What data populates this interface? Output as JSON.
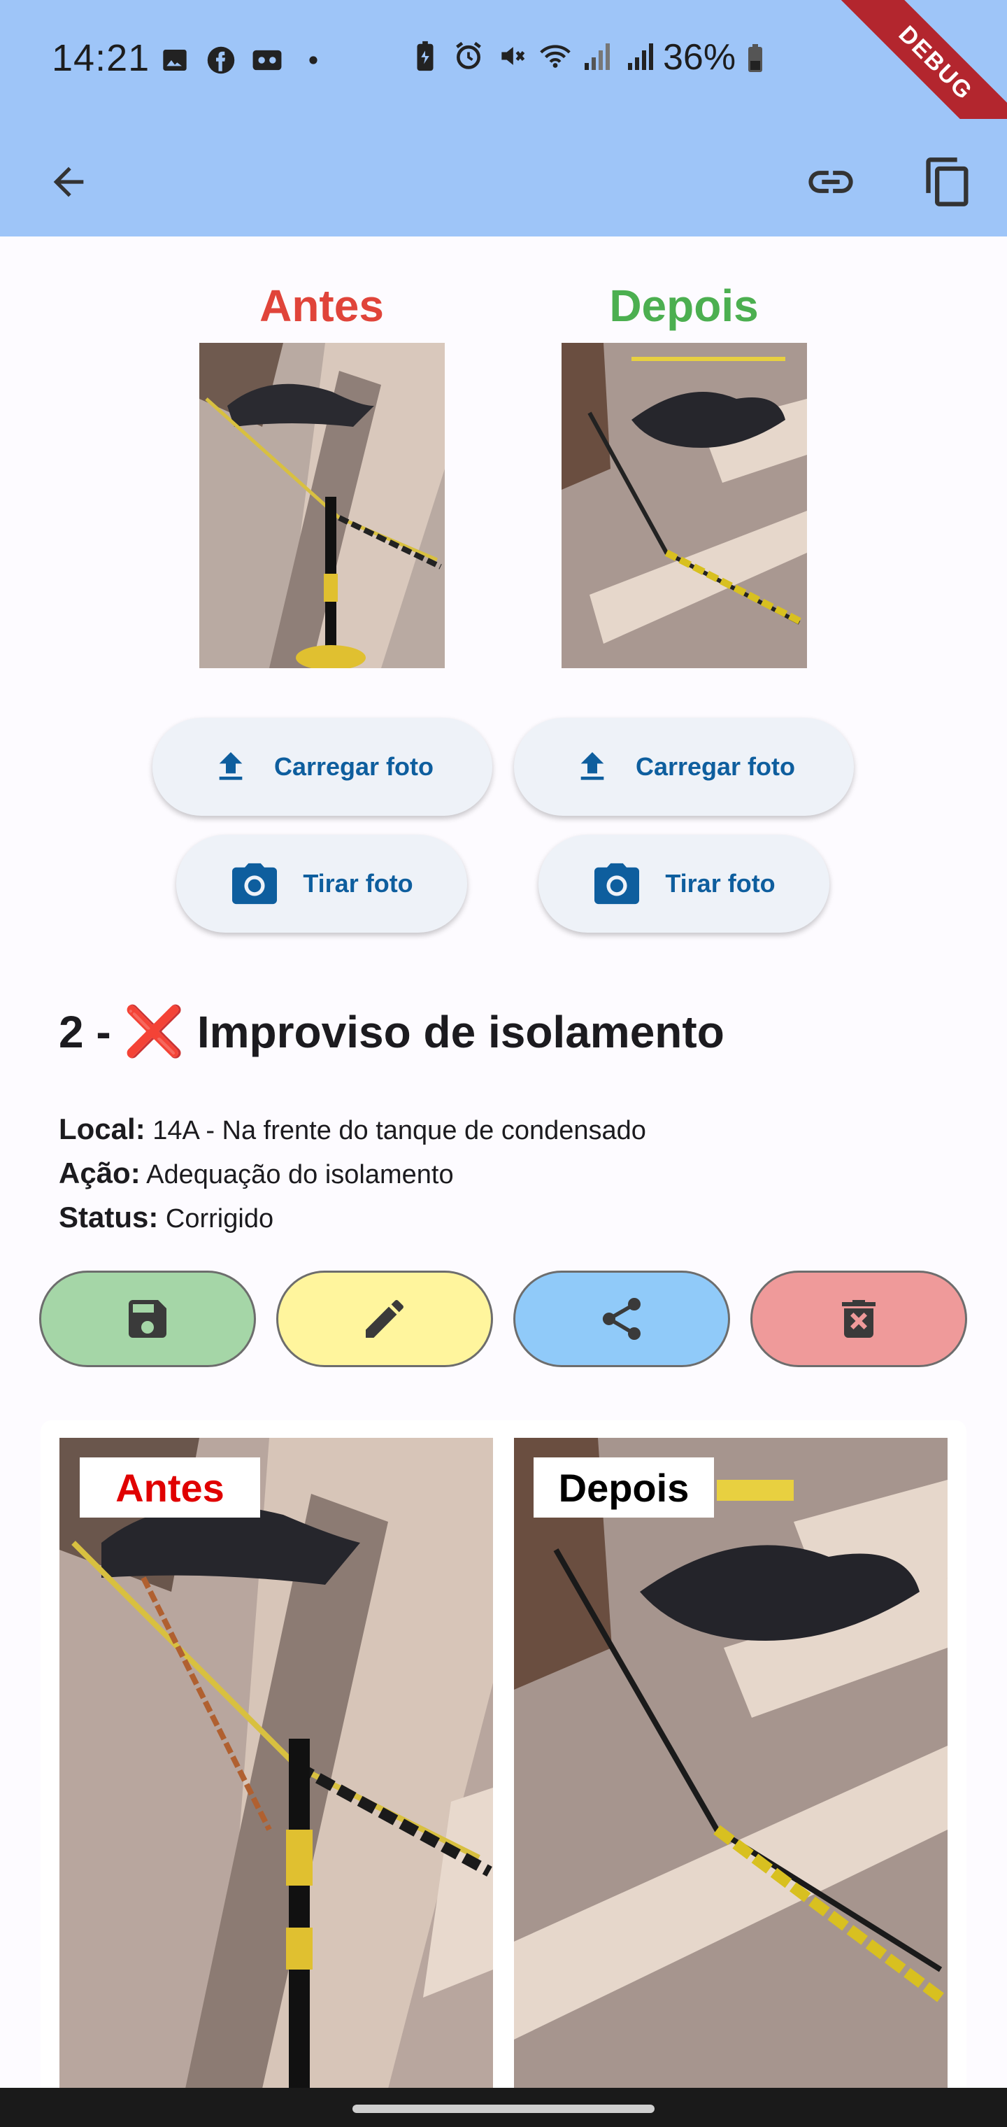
{
  "status_bar": {
    "time": "14:21",
    "battery_text": "36%",
    "left_icons": [
      "gallery-icon",
      "facebook-icon",
      "voicemail-icon",
      "dot-icon"
    ],
    "right_icons": [
      "battery-saver-icon",
      "alarm-icon",
      "mute-icon",
      "wifi-icon",
      "signal-icon",
      "signal-icon",
      "battery-icon"
    ]
  },
  "debug_banner": "DEBUG",
  "app_bar": {
    "back_icon": "arrow-back-icon",
    "link_icon": "link-icon",
    "copy_icon": "copy-icon"
  },
  "before": {
    "title": "Antes",
    "title_color": "#e0443a",
    "upload_label": "Carregar foto",
    "camera_label": "Tirar foto"
  },
  "after": {
    "title": "Depois",
    "title_color": "#4caf50",
    "upload_label": "Carregar foto",
    "camera_label": "Tirar foto"
  },
  "item": {
    "number_prefix": "2 -",
    "status_emoji": "❌",
    "title": "Improviso de isolamento",
    "local_label": "Local:",
    "local_value": "14A - Na frente do tanque de condensado",
    "acao_label": "Ação:",
    "acao_value": "Adequação do isolamento",
    "status_label": "Status:",
    "status_value": "Corrigido"
  },
  "actions": [
    {
      "name": "save-button",
      "icon": "save-icon",
      "color": "#a5d6a7"
    },
    {
      "name": "edit-button",
      "icon": "edit-icon",
      "color": "#fff59d"
    },
    {
      "name": "share-button",
      "icon": "share-icon",
      "color": "#90caf9"
    },
    {
      "name": "delete-button",
      "icon": "delete-icon",
      "color": "#ef9a9a"
    }
  ],
  "preview": {
    "before_label": "Antes",
    "before_label_color": "#e00000",
    "after_label": "Depois",
    "after_label_color": "#000000"
  }
}
